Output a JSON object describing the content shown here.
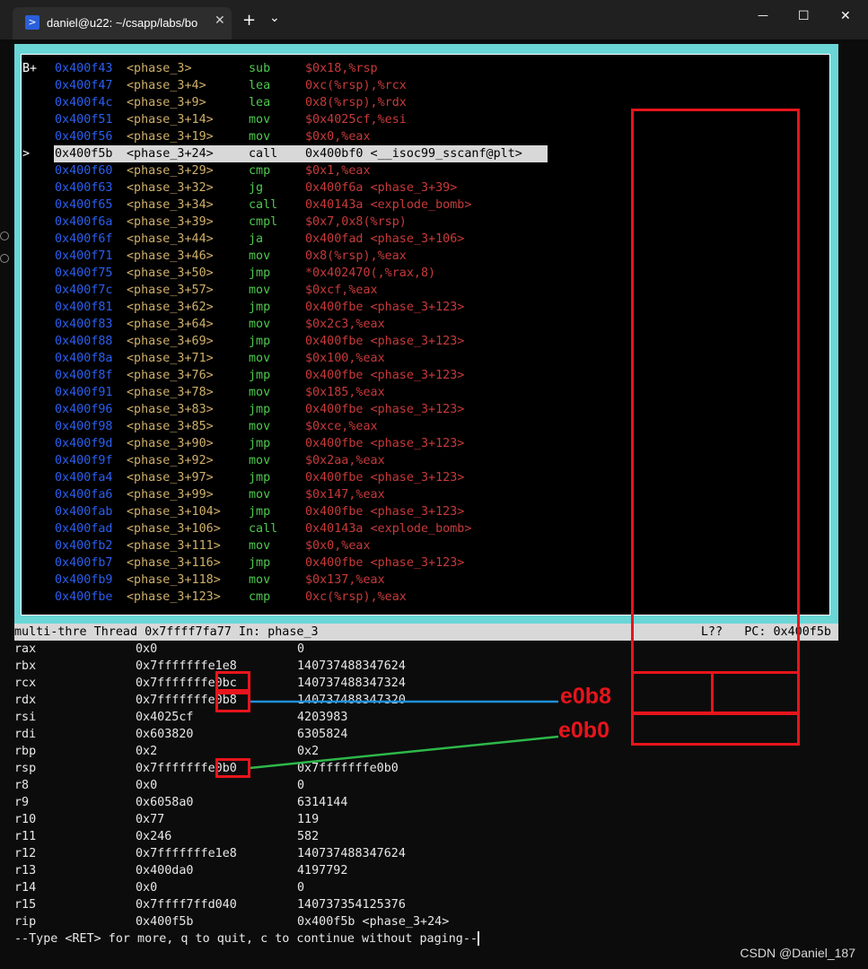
{
  "window": {
    "tab_title": "daniel@u22: ~/csapp/labs/bo",
    "tab_icon": "powershell-icon",
    "new_tab": "+",
    "dropdown": "⌄",
    "minimize": "—",
    "maximize": "☐",
    "close": "✕",
    "tab_close": "✕"
  },
  "asm": [
    {
      "mark": "B+",
      "addr": "0x400f43",
      "sym": "<phase_3>",
      "mn": "sub",
      "ops": "$0x18,%rsp"
    },
    {
      "mark": "",
      "addr": "0x400f47",
      "sym": "<phase_3+4>",
      "mn": "lea",
      "ops": "0xc(%rsp),%rcx"
    },
    {
      "mark": "",
      "addr": "0x400f4c",
      "sym": "<phase_3+9>",
      "mn": "lea",
      "ops": "0x8(%rsp),%rdx"
    },
    {
      "mark": "",
      "addr": "0x400f51",
      "sym": "<phase_3+14>",
      "mn": "mov",
      "ops": "$0x4025cf,%esi"
    },
    {
      "mark": "",
      "addr": "0x400f56",
      "sym": "<phase_3+19>",
      "mn": "mov",
      "ops": "$0x0,%eax"
    },
    {
      "mark": ">",
      "addr": "0x400f5b",
      "sym": "<phase_3+24>",
      "mn": "call",
      "ops": "0x400bf0 <__isoc99_sscanf@plt>",
      "current": true
    },
    {
      "mark": "",
      "addr": "0x400f60",
      "sym": "<phase_3+29>",
      "mn": "cmp",
      "ops": "$0x1,%eax"
    },
    {
      "mark": "",
      "addr": "0x400f63",
      "sym": "<phase_3+32>",
      "mn": "jg",
      "ops": "0x400f6a <phase_3+39>"
    },
    {
      "mark": "",
      "addr": "0x400f65",
      "sym": "<phase_3+34>",
      "mn": "call",
      "ops": "0x40143a <explode_bomb>"
    },
    {
      "mark": "",
      "addr": "0x400f6a",
      "sym": "<phase_3+39>",
      "mn": "cmpl",
      "ops": "$0x7,0x8(%rsp)"
    },
    {
      "mark": "",
      "addr": "0x400f6f",
      "sym": "<phase_3+44>",
      "mn": "ja",
      "ops": "0x400fad <phase_3+106>"
    },
    {
      "mark": "",
      "addr": "0x400f71",
      "sym": "<phase_3+46>",
      "mn": "mov",
      "ops": "0x8(%rsp),%eax"
    },
    {
      "mark": "",
      "addr": "0x400f75",
      "sym": "<phase_3+50>",
      "mn": "jmp",
      "ops": "*0x402470(,%rax,8)"
    },
    {
      "mark": "",
      "addr": "0x400f7c",
      "sym": "<phase_3+57>",
      "mn": "mov",
      "ops": "$0xcf,%eax"
    },
    {
      "mark": "",
      "addr": "0x400f81",
      "sym": "<phase_3+62>",
      "mn": "jmp",
      "ops": "0x400fbe <phase_3+123>"
    },
    {
      "mark": "",
      "addr": "0x400f83",
      "sym": "<phase_3+64>",
      "mn": "mov",
      "ops": "$0x2c3,%eax"
    },
    {
      "mark": "",
      "addr": "0x400f88",
      "sym": "<phase_3+69>",
      "mn": "jmp",
      "ops": "0x400fbe <phase_3+123>"
    },
    {
      "mark": "",
      "addr": "0x400f8a",
      "sym": "<phase_3+71>",
      "mn": "mov",
      "ops": "$0x100,%eax"
    },
    {
      "mark": "",
      "addr": "0x400f8f",
      "sym": "<phase_3+76>",
      "mn": "jmp",
      "ops": "0x400fbe <phase_3+123>"
    },
    {
      "mark": "",
      "addr": "0x400f91",
      "sym": "<phase_3+78>",
      "mn": "mov",
      "ops": "$0x185,%eax"
    },
    {
      "mark": "",
      "addr": "0x400f96",
      "sym": "<phase_3+83>",
      "mn": "jmp",
      "ops": "0x400fbe <phase_3+123>"
    },
    {
      "mark": "",
      "addr": "0x400f98",
      "sym": "<phase_3+85>",
      "mn": "mov",
      "ops": "$0xce,%eax"
    },
    {
      "mark": "",
      "addr": "0x400f9d",
      "sym": "<phase_3+90>",
      "mn": "jmp",
      "ops": "0x400fbe <phase_3+123>"
    },
    {
      "mark": "",
      "addr": "0x400f9f",
      "sym": "<phase_3+92>",
      "mn": "mov",
      "ops": "$0x2aa,%eax"
    },
    {
      "mark": "",
      "addr": "0x400fa4",
      "sym": "<phase_3+97>",
      "mn": "jmp",
      "ops": "0x400fbe <phase_3+123>"
    },
    {
      "mark": "",
      "addr": "0x400fa6",
      "sym": "<phase_3+99>",
      "mn": "mov",
      "ops": "$0x147,%eax"
    },
    {
      "mark": "",
      "addr": "0x400fab",
      "sym": "<phase_3+104>",
      "mn": "jmp",
      "ops": "0x400fbe <phase_3+123>"
    },
    {
      "mark": "",
      "addr": "0x400fad",
      "sym": "<phase_3+106>",
      "mn": "call",
      "ops": "0x40143a <explode_bomb>"
    },
    {
      "mark": "",
      "addr": "0x400fb2",
      "sym": "<phase_3+111>",
      "mn": "mov",
      "ops": "$0x0,%eax"
    },
    {
      "mark": "",
      "addr": "0x400fb7",
      "sym": "<phase_3+116>",
      "mn": "jmp",
      "ops": "0x400fbe <phase_3+123>"
    },
    {
      "mark": "",
      "addr": "0x400fb9",
      "sym": "<phase_3+118>",
      "mn": "mov",
      "ops": "$0x137,%eax"
    },
    {
      "mark": "",
      "addr": "0x400fbe",
      "sym": "<phase_3+123>",
      "mn": "cmp",
      "ops": "0xc(%rsp),%eax"
    }
  ],
  "status": {
    "left": "multi-thre Thread 0x7ffff7fa77 In: phase_3",
    "right": "L??   PC: 0x400f5b"
  },
  "registers": [
    {
      "name": "rax",
      "hex": "0x0",
      "natural": "0"
    },
    {
      "name": "rbx",
      "hex": "0x7fffffffe1e8",
      "natural": "140737488347624"
    },
    {
      "name": "rcx",
      "hex": "0x7fffffffe0bc",
      "natural": "140737488347324"
    },
    {
      "name": "rdx",
      "hex": "0x7fffffffe0b8",
      "natural": "140737488347320"
    },
    {
      "name": "rsi",
      "hex": "0x4025cf",
      "natural": "4203983"
    },
    {
      "name": "rdi",
      "hex": "0x603820",
      "natural": "6305824"
    },
    {
      "name": "rbp",
      "hex": "0x2",
      "natural": "0x2"
    },
    {
      "name": "rsp",
      "hex": "0x7fffffffe0b0",
      "natural": "0x7fffffffe0b0"
    },
    {
      "name": "r8",
      "hex": "0x0",
      "natural": "0"
    },
    {
      "name": "r9",
      "hex": "0x6058a0",
      "natural": "6314144"
    },
    {
      "name": "r10",
      "hex": "0x77",
      "natural": "119"
    },
    {
      "name": "r11",
      "hex": "0x246",
      "natural": "582"
    },
    {
      "name": "r12",
      "hex": "0x7fffffffe1e8",
      "natural": "140737488347624"
    },
    {
      "name": "r13",
      "hex": "0x400da0",
      "natural": "4197792"
    },
    {
      "name": "r14",
      "hex": "0x0",
      "natural": "0"
    },
    {
      "name": "r15",
      "hex": "0x7ffff7ffd040",
      "natural": "140737354125376"
    },
    {
      "name": "rip",
      "hex": "0x400f5b",
      "natural": "0x400f5b <phase_3+24>"
    }
  ],
  "prompt": "--Type <RET> for more, q to quit, c to continue without paging--",
  "annotations": {
    "label_1": "e0b8",
    "label_2": "e0b0",
    "box_color": "#e8141c",
    "line_blue": "#1e90d8",
    "line_green": "#2db84a"
  },
  "watermark": "CSDN @Daniel_187"
}
